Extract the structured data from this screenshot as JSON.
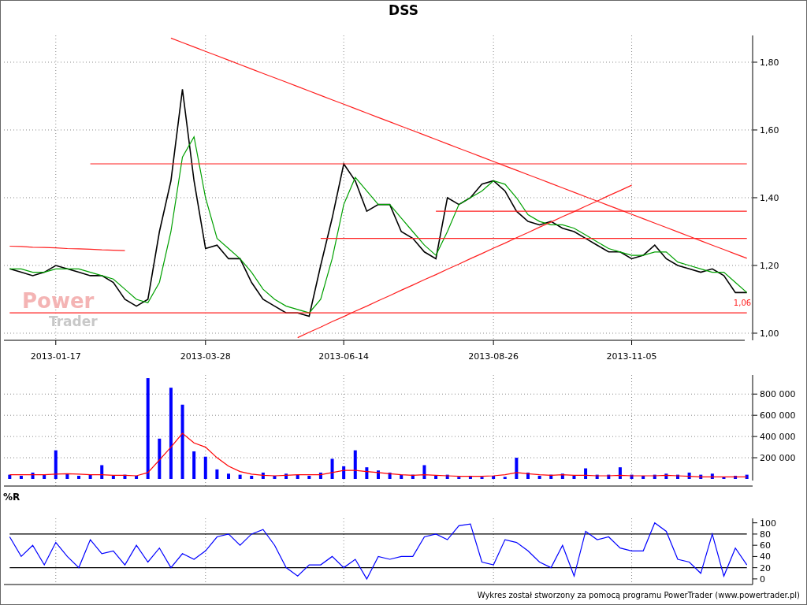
{
  "title": "DSS",
  "logo": {
    "line_1": "Power",
    "line_2": "Trader"
  },
  "price_panel": {
    "chart_data": {
      "type": "line",
      "grid": true,
      "ylim": [
        0.979,
        1.879
      ],
      "categories": [
        null,
        null,
        null,
        null,
        "2013-01-17",
        null,
        null,
        null,
        null,
        null,
        null,
        null,
        null,
        null,
        null,
        null,
        null,
        "2013-03-28",
        null,
        null,
        null,
        null,
        null,
        null,
        null,
        null,
        null,
        null,
        null,
        "2013-06-14",
        null,
        null,
        null,
        null,
        null,
        null,
        null,
        null,
        null,
        null,
        null,
        null,
        "2013-08-26",
        null,
        null,
        null,
        null,
        null,
        null,
        null,
        null,
        null,
        null,
        null,
        "2013-11-05",
        null,
        null,
        null,
        null,
        null,
        null,
        null,
        null,
        null,
        null
      ],
      "yticks": [
        {
          "value": 1.0,
          "label": "1,00"
        },
        {
          "value": 1.2,
          "label": "1,20"
        },
        {
          "value": 1.4,
          "label": "1,40"
        },
        {
          "value": 1.6,
          "label": "1,60"
        },
        {
          "value": 1.8,
          "label": "1,80"
        }
      ],
      "series": [
        {
          "color": "#000000",
          "values": [
            1.19,
            1.18,
            1.17,
            1.18,
            1.2,
            1.19,
            1.18,
            1.17,
            1.17,
            1.15,
            1.1,
            1.08,
            1.1,
            1.3,
            1.45,
            1.72,
            1.45,
            1.25,
            1.26,
            1.22,
            1.22,
            1.15,
            1.1,
            1.08,
            1.06,
            1.06,
            1.05,
            1.2,
            1.34,
            1.5,
            1.45,
            1.36,
            1.38,
            1.38,
            1.3,
            1.28,
            1.24,
            1.22,
            1.4,
            1.38,
            1.4,
            1.44,
            1.45,
            1.42,
            1.36,
            1.33,
            1.32,
            1.33,
            1.31,
            1.3,
            1.28,
            1.26,
            1.24,
            1.24,
            1.22,
            1.23,
            1.26,
            1.22,
            1.2,
            1.19,
            1.18,
            1.19,
            1.17,
            1.12,
            1.12
          ]
        },
        {
          "color": "#00a000",
          "values": [
            1.19,
            1.19,
            1.18,
            1.18,
            1.19,
            1.19,
            1.19,
            1.18,
            1.17,
            1.16,
            1.13,
            1.1,
            1.09,
            1.15,
            1.3,
            1.52,
            1.58,
            1.4,
            1.28,
            1.25,
            1.22,
            1.18,
            1.13,
            1.1,
            1.08,
            1.07,
            1.06,
            1.1,
            1.22,
            1.38,
            1.46,
            1.42,
            1.38,
            1.38,
            1.34,
            1.3,
            1.26,
            1.23,
            1.3,
            1.38,
            1.4,
            1.42,
            1.45,
            1.44,
            1.4,
            1.35,
            1.33,
            1.32,
            1.32,
            1.31,
            1.29,
            1.27,
            1.25,
            1.24,
            1.23,
            1.23,
            1.24,
            1.24,
            1.21,
            1.2,
            1.19,
            1.18,
            1.18,
            1.15,
            1.12
          ]
        },
        {
          "color": "#ff2020",
          "values": [
            1.257,
            1.256,
            1.254,
            1.253,
            1.252,
            1.25,
            1.249,
            1.248,
            1.246,
            1.245,
            1.244,
            null,
            null,
            null,
            null,
            null,
            null,
            null,
            null,
            null,
            null,
            null,
            null,
            null,
            null,
            null,
            null,
            null,
            null,
            null,
            null,
            null,
            null,
            null,
            null,
            null,
            null,
            null,
            null,
            null,
            null,
            null,
            null,
            null,
            null,
            null,
            null,
            null,
            null,
            null,
            null,
            null,
            null,
            null,
            null,
            null,
            null,
            null,
            null,
            null,
            null,
            null,
            null,
            null,
            null
          ]
        },
        {
          "color": "#ff2020",
          "values": [
            null,
            null,
            null,
            null,
            null,
            null,
            null,
            null,
            null,
            null,
            null,
            null,
            null,
            null,
            1.871,
            1.858,
            1.845,
            1.832,
            1.819,
            1.806,
            1.793,
            1.78,
            1.767,
            1.754,
            1.741,
            1.728,
            1.715,
            1.702,
            1.689,
            1.676,
            1.663,
            1.65,
            1.637,
            1.624,
            1.611,
            1.598,
            1.585,
            1.572,
            1.559,
            1.546,
            1.533,
            1.52,
            1.507,
            1.494,
            1.481,
            1.468,
            1.455,
            1.442,
            1.429,
            1.416,
            1.403,
            1.39,
            1.377,
            1.364,
            1.351,
            1.338,
            1.325,
            1.312,
            1.299,
            1.286,
            1.273,
            1.26,
            1.247,
            1.234,
            1.221
          ]
        },
        {
          "color": "#ff2020",
          "values": [
            null,
            null,
            null,
            null,
            null,
            null,
            null,
            1.5,
            1.5,
            1.5,
            1.5,
            1.5,
            1.5,
            1.5,
            1.5,
            1.5,
            1.5,
            1.5,
            1.5,
            1.5,
            1.5,
            1.5,
            1.5,
            1.5,
            1.5,
            1.5,
            1.5,
            1.5,
            1.5,
            1.5,
            1.5,
            1.5,
            1.5,
            1.5,
            1.5,
            1.5,
            1.5,
            1.5,
            1.5,
            1.5,
            1.5,
            1.5,
            1.5,
            1.5,
            1.5,
            1.5,
            1.5,
            1.5,
            1.5,
            1.5,
            1.5,
            1.5,
            1.5,
            1.5,
            1.5,
            1.5,
            1.5,
            1.5,
            1.5,
            1.5,
            1.5,
            1.5,
            1.5,
            1.5,
            1.5
          ]
        },
        {
          "color": "#ff2020",
          "values": [
            null,
            null,
            null,
            null,
            null,
            null,
            null,
            null,
            null,
            null,
            null,
            null,
            null,
            null,
            null,
            null,
            null,
            null,
            null,
            null,
            null,
            null,
            null,
            null,
            null,
            null,
            null,
            null,
            null,
            null,
            null,
            null,
            null,
            null,
            null,
            null,
            null,
            1.36,
            1.36,
            1.36,
            1.36,
            1.36,
            1.36,
            1.36,
            1.36,
            1.36,
            1.36,
            1.36,
            1.36,
            1.36,
            1.36,
            1.36,
            1.36,
            1.36,
            1.36,
            1.36,
            1.36,
            1.36,
            1.36,
            1.36,
            1.36,
            1.36,
            1.36,
            1.36,
            1.36
          ]
        },
        {
          "color": "#ff2020",
          "values": [
            null,
            null,
            null,
            null,
            null,
            null,
            null,
            null,
            null,
            null,
            null,
            null,
            null,
            null,
            null,
            null,
            null,
            null,
            null,
            null,
            null,
            null,
            null,
            null,
            null,
            null,
            null,
            1.28,
            1.28,
            1.28,
            1.28,
            1.28,
            1.28,
            1.28,
            1.28,
            1.28,
            1.28,
            1.28,
            1.28,
            1.28,
            1.28,
            1.28,
            1.28,
            1.28,
            1.28,
            1.28,
            1.28,
            1.28,
            1.28,
            1.28,
            1.28,
            1.28,
            1.28,
            1.28,
            1.28,
            1.28,
            1.28,
            1.28,
            1.28,
            1.28,
            1.28,
            1.28,
            1.28,
            1.28,
            1.28
          ]
        },
        {
          "color": "#ff2020",
          "values": [
            1.06,
            1.06,
            1.06,
            1.06,
            1.06,
            1.06,
            1.06,
            1.06,
            1.06,
            1.06,
            1.06,
            1.06,
            1.06,
            1.06,
            1.06,
            1.06,
            1.06,
            1.06,
            1.06,
            1.06,
            1.06,
            1.06,
            1.06,
            1.06,
            1.06,
            1.06,
            1.06,
            1.06,
            1.06,
            1.06,
            1.06,
            1.06,
            1.06,
            1.06,
            1.06,
            1.06,
            1.06,
            1.06,
            1.06,
            1.06,
            1.06,
            1.06,
            1.06,
            1.06,
            1.06,
            1.06,
            1.06,
            1.06,
            1.06,
            1.06,
            1.06,
            1.06,
            1.06,
            1.06,
            1.06,
            1.06,
            1.06,
            1.06,
            1.06,
            1.06,
            1.06,
            1.06,
            1.06,
            1.06,
            1.06
          ]
        },
        {
          "color": "#ff2020",
          "values": [
            null,
            null,
            null,
            null,
            null,
            null,
            null,
            null,
            null,
            null,
            null,
            null,
            null,
            null,
            null,
            null,
            null,
            null,
            null,
            null,
            null,
            null,
            null,
            null,
            null,
            0.987,
            1.003,
            1.018,
            1.034,
            1.049,
            1.065,
            1.08,
            1.096,
            1.111,
            1.127,
            1.142,
            1.158,
            1.173,
            1.189,
            1.204,
            1.22,
            1.235,
            1.251,
            1.266,
            1.282,
            1.297,
            1.313,
            1.328,
            1.344,
            1.359,
            1.375,
            1.39,
            1.406,
            1.421,
            1.437,
            null,
            null,
            null,
            null,
            null,
            null,
            null,
            null,
            null,
            null
          ]
        }
      ],
      "annotations": [
        "1,06"
      ]
    }
  },
  "volume_panel": {
    "chart_data": {
      "type": "bar",
      "grid": true,
      "ylim": [
        0,
        980000
      ],
      "yticks": [
        {
          "value": 200000,
          "label": "200 000"
        },
        {
          "value": 400000,
          "label": "400 000"
        },
        {
          "value": 600000,
          "label": "600 000"
        },
        {
          "value": 800000,
          "label": "800 000"
        }
      ],
      "series": [
        {
          "color": "#0000ff",
          "values": [
            40000,
            30000,
            60000,
            40000,
            270000,
            50000,
            30000,
            40000,
            130000,
            30000,
            40000,
            30000,
            950000,
            380000,
            860000,
            700000,
            260000,
            210000,
            90000,
            50000,
            40000,
            30000,
            60000,
            30000,
            50000,
            40000,
            30000,
            60000,
            190000,
            120000,
            270000,
            110000,
            80000,
            60000,
            40000,
            40000,
            130000,
            30000,
            40000,
            20000,
            30000,
            20000,
            30000,
            20000,
            200000,
            60000,
            30000,
            40000,
            50000,
            30000,
            100000,
            40000,
            40000,
            110000,
            40000,
            30000,
            40000,
            50000,
            40000,
            60000,
            40000,
            50000,
            20000,
            30000,
            40000
          ]
        },
        {
          "type": "line",
          "color": "#ff0000",
          "values": [
            40000,
            40000,
            40000,
            40000,
            45000,
            50000,
            45000,
            40000,
            40000,
            35000,
            35000,
            30000,
            60000,
            180000,
            300000,
            430000,
            340000,
            300000,
            200000,
            120000,
            70000,
            45000,
            35000,
            30000,
            35000,
            40000,
            40000,
            40000,
            60000,
            80000,
            80000,
            70000,
            60000,
            50000,
            40000,
            35000,
            40000,
            35000,
            30000,
            25000,
            25000,
            25000,
            30000,
            40000,
            60000,
            50000,
            40000,
            35000,
            40000,
            35000,
            35000,
            30000,
            30000,
            35000,
            30000,
            30000,
            30000,
            35000,
            30000,
            25000,
            20000,
            20000,
            20000,
            20000,
            20000
          ]
        }
      ]
    }
  },
  "williams_r_panel": {
    "label": "%R",
    "chart_data": {
      "type": "line",
      "grid": true,
      "ylim": [
        -10,
        108
      ],
      "yticks": [
        {
          "value": 0,
          "label": "0"
        },
        {
          "value": 20,
          "label": "20"
        },
        {
          "value": 40,
          "label": "40"
        },
        {
          "value": 60,
          "label": "60"
        },
        {
          "value": 80,
          "label": "80"
        },
        {
          "value": 100,
          "label": "100"
        }
      ],
      "series": [
        {
          "color": "#000000",
          "values": [
            80,
            80,
            80,
            80,
            80,
            80,
            80,
            80,
            80,
            80,
            80,
            80,
            80,
            80,
            80,
            80,
            80,
            80,
            80,
            80,
            80,
            80,
            80,
            80,
            80,
            80,
            80,
            80,
            80,
            80,
            80,
            80,
            80,
            80,
            80,
            80,
            80,
            80,
            80,
            80,
            80,
            80,
            80,
            80,
            80,
            80,
            80,
            80,
            80,
            80,
            80,
            80,
            80,
            80,
            80,
            80,
            80,
            80,
            80,
            80,
            80,
            80,
            80,
            80,
            80
          ]
        },
        {
          "color": "#000000",
          "values": [
            20,
            20,
            20,
            20,
            20,
            20,
            20,
            20,
            20,
            20,
            20,
            20,
            20,
            20,
            20,
            20,
            20,
            20,
            20,
            20,
            20,
            20,
            20,
            20,
            20,
            20,
            20,
            20,
            20,
            20,
            20,
            20,
            20,
            20,
            20,
            20,
            20,
            20,
            20,
            20,
            20,
            20,
            20,
            20,
            20,
            20,
            20,
            20,
            20,
            20,
            20,
            20,
            20,
            20,
            20,
            20,
            20,
            20,
            20,
            20,
            20,
            20,
            20,
            20,
            20
          ]
        },
        {
          "color": "#0000ff",
          "values": [
            75,
            40,
            60,
            25,
            65,
            40,
            20,
            70,
            45,
            50,
            25,
            60,
            30,
            55,
            20,
            45,
            35,
            50,
            75,
            80,
            60,
            80,
            88,
            60,
            20,
            5,
            25,
            25,
            40,
            20,
            35,
            0,
            40,
            35,
            40,
            40,
            75,
            80,
            70,
            95,
            98,
            30,
            25,
            70,
            65,
            50,
            30,
            20,
            60,
            5,
            85,
            70,
            75,
            55,
            50,
            50,
            100,
            85,
            35,
            30,
            10,
            80,
            5,
            55,
            25
          ]
        }
      ]
    }
  },
  "footer": "Wykres został stworzony za pomocą programu PowerTrader (www.powertrader.pl)"
}
